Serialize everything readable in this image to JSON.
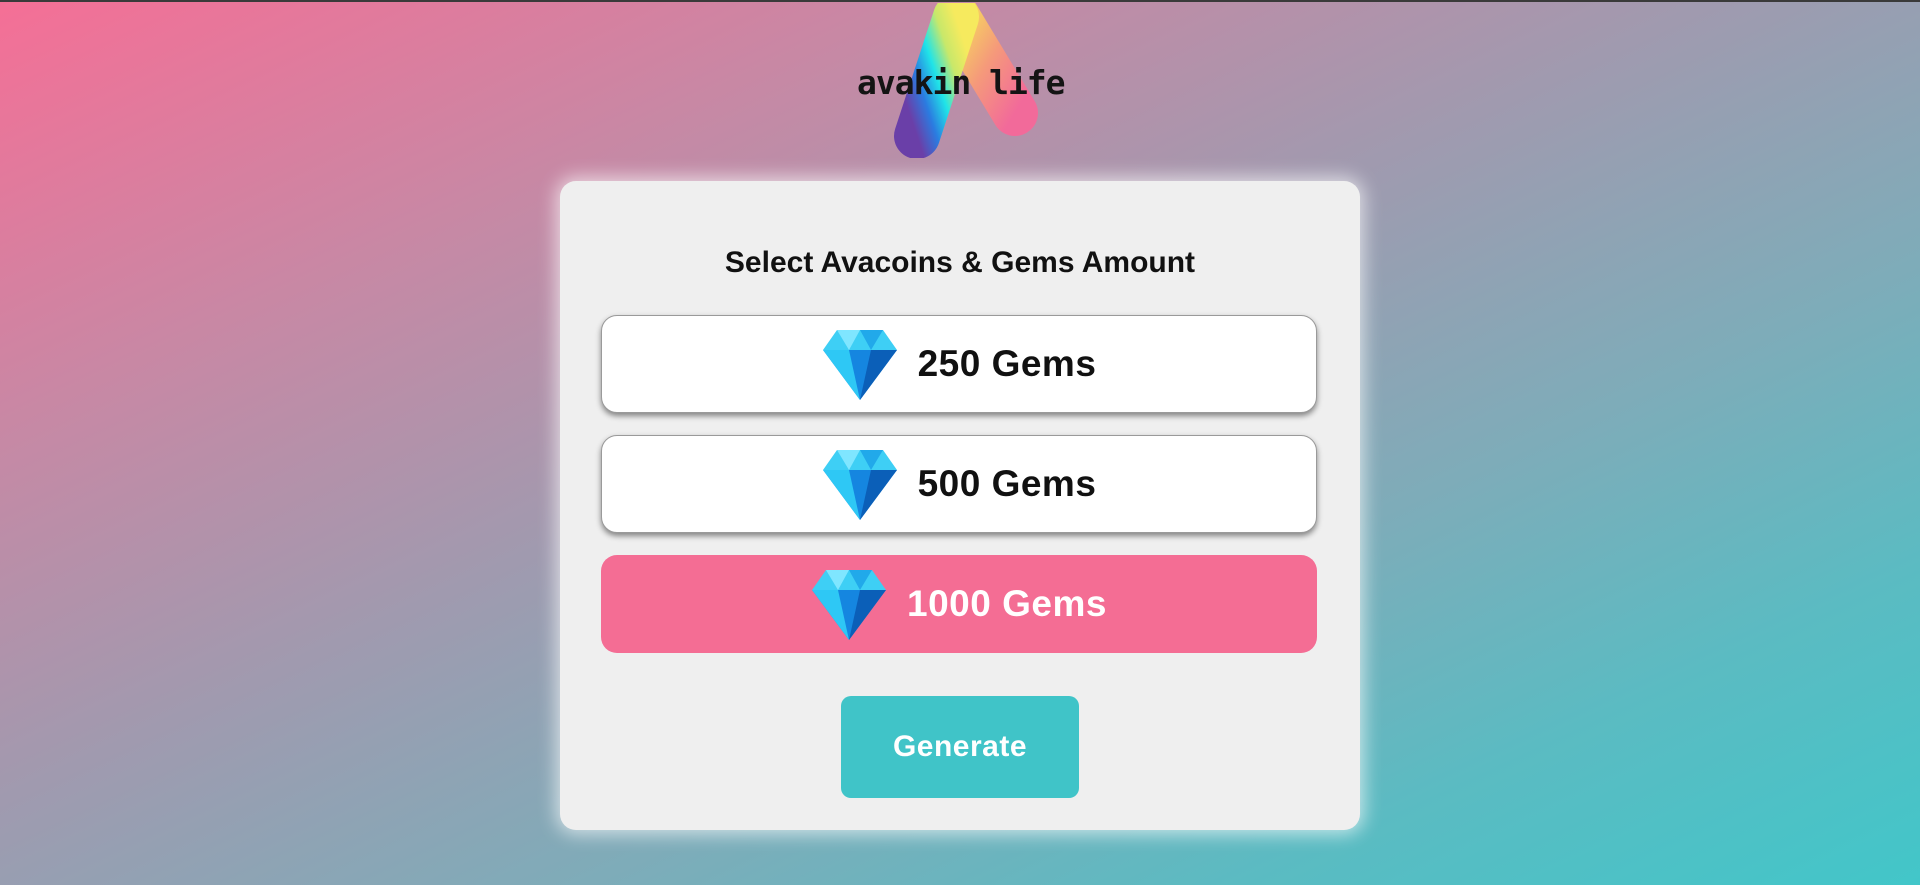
{
  "brand": {
    "logo_text": "avakin life"
  },
  "card": {
    "title": "Select Avacoins & Gems Amount",
    "options": [
      {
        "label": "250 Gems",
        "icon": "gem-icon",
        "selected": false
      },
      {
        "label": "500 Gems",
        "icon": "gem-icon",
        "selected": false
      },
      {
        "label": "1000 Gems",
        "icon": "gem-icon",
        "selected": true
      }
    ],
    "generate_label": "Generate"
  },
  "colors": {
    "accent_pink": "#f46d94",
    "accent_teal": "#40c4c8",
    "card_bg": "#efefef"
  }
}
